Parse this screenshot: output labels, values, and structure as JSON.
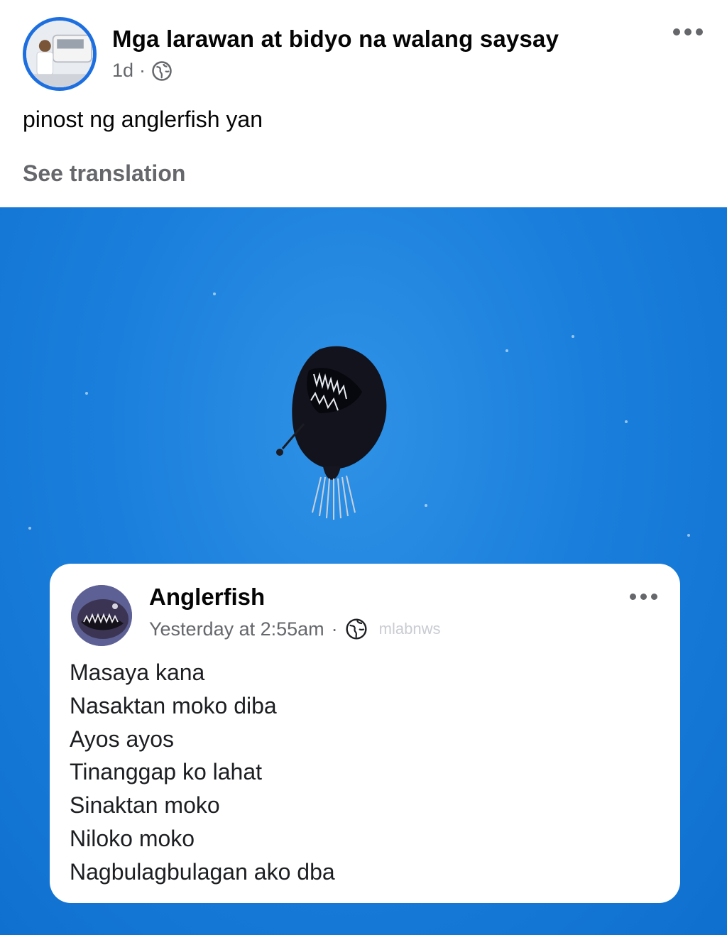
{
  "post": {
    "page_name": "Mga larawan at bidyo na walang saysay",
    "time": "1d",
    "separator": "·",
    "caption": "pinost ng anglerfish yan",
    "see_translation": "See translation",
    "privacy_icon": "globe-icon",
    "more_icon": "more-horizontal-icon"
  },
  "embedded_post": {
    "name": "Anglerfish",
    "time": "Yesterday at 2:55am",
    "separator": "·",
    "watermark": "mlabnws",
    "privacy_icon": "globe-icon",
    "lines": [
      "Masaya kana",
      "Nasaktan moko diba",
      "Ayos ayos",
      "Tinanggap ko lahat",
      "Sinaktan moko",
      "Niloko moko",
      "Nagbulagbulagan ako dba"
    ]
  },
  "colors": {
    "avatar_ring": "#1d6fe0",
    "ocean": "#1a7fdc",
    "secondary_text": "#65676b"
  }
}
